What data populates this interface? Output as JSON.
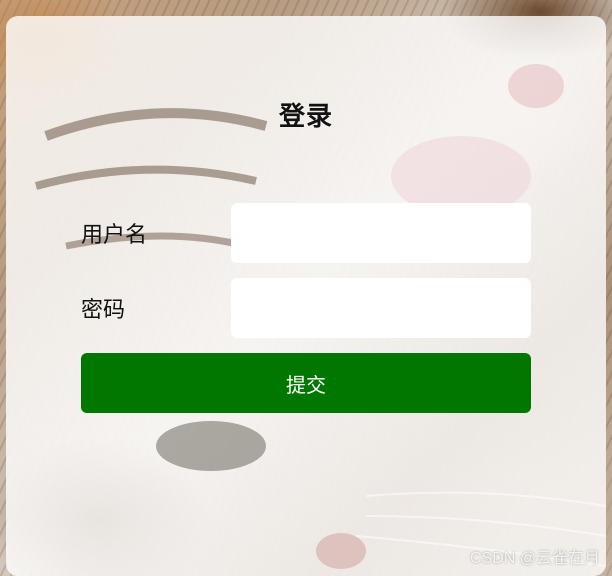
{
  "login": {
    "title": "登录",
    "username_label": "用户名",
    "username_value": "",
    "username_placeholder": "",
    "password_label": "密码",
    "password_value": "",
    "password_placeholder": "",
    "submit_label": "提交"
  },
  "watermark": {
    "text": "CSDN @云雀在月"
  },
  "colors": {
    "submit_button": "#007800",
    "card_background": "#ffffffcc",
    "input_background": "#ffffff"
  }
}
